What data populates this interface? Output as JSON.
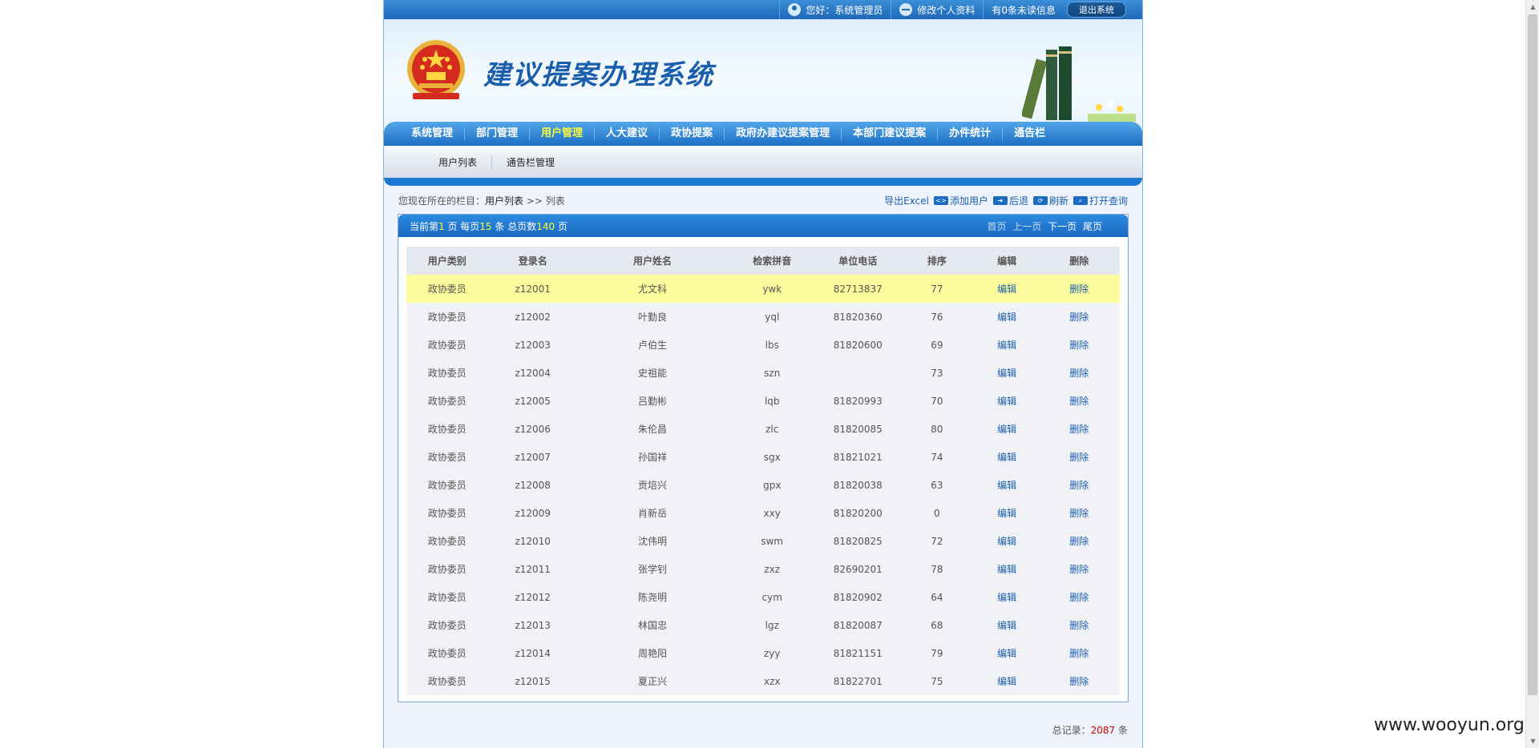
{
  "topbar": {
    "greeting": "您好：系统管理员",
    "edit_profile": "修改个人资料",
    "messages": "有0条未读信息",
    "logout": "退出系统"
  },
  "banner": {
    "title": "建议提案办理系统"
  },
  "nav": {
    "items": [
      "系统管理",
      "部门管理",
      "用户管理",
      "人大建议",
      "政协提案",
      "政府办建议提案管理",
      "本部门建议提案",
      "办件统计",
      "通告栏"
    ],
    "active_index": 2
  },
  "subnav": {
    "items": [
      "用户列表",
      "通告栏管理"
    ]
  },
  "breadcrumb": {
    "prefix": "您现在所在的栏目：",
    "current": "用户列表",
    "sep": " >> ",
    "page": "列表"
  },
  "actions": [
    "导出Excel",
    "添加用户",
    "后退",
    "刷新",
    "打开查询"
  ],
  "paging": {
    "pre": "当前第",
    "page": "1",
    "mid1": " 页 每页",
    "per": "15",
    "mid2": " 条 总页数",
    "pages": "140",
    "post": " 页",
    "first": "首页",
    "prev": "上一页",
    "next": "下一页",
    "last": "尾页"
  },
  "table": {
    "headers": [
      "用户类别",
      "登录名",
      "用户姓名",
      "检索拼音",
      "单位电话",
      "排序",
      "编辑",
      "删除"
    ],
    "rows": [
      [
        "政协委员",
        "z12001",
        "尤文科",
        "ywk",
        "82713837",
        "77",
        "编辑",
        "删除"
      ],
      [
        "政协委员",
        "z12002",
        "叶勤良",
        "yql",
        "81820360",
        "76",
        "编辑",
        "删除"
      ],
      [
        "政协委员",
        "z12003",
        "卢伯生",
        "lbs",
        "81820600",
        "69",
        "编辑",
        "删除"
      ],
      [
        "政协委员",
        "z12004",
        "史祖能",
        "szn",
        "",
        "73",
        "编辑",
        "删除"
      ],
      [
        "政协委员",
        "z12005",
        "吕勤彬",
        "lqb",
        "81820993",
        "70",
        "编辑",
        "删除"
      ],
      [
        "政协委员",
        "z12006",
        "朱伦昌",
        "zlc",
        "81820085",
        "80",
        "编辑",
        "删除"
      ],
      [
        "政协委员",
        "z12007",
        "孙国祥",
        "sgx",
        "81821021",
        "74",
        "编辑",
        "删除"
      ],
      [
        "政协委员",
        "z12008",
        "贡培兴",
        "gpx",
        "81820038",
        "63",
        "编辑",
        "删除"
      ],
      [
        "政协委员",
        "z12009",
        "肖新岳",
        "xxy",
        "81820200",
        "0",
        "编辑",
        "删除"
      ],
      [
        "政协委员",
        "z12010",
        "沈伟明",
        "swm",
        "81820825",
        "72",
        "编辑",
        "删除"
      ],
      [
        "政协委员",
        "z12011",
        "张学钊",
        "zxz",
        "82690201",
        "78",
        "编辑",
        "删除"
      ],
      [
        "政协委员",
        "z12012",
        "陈尧明",
        "cym",
        "81820902",
        "64",
        "编辑",
        "删除"
      ],
      [
        "政协委员",
        "z12013",
        "林国忠",
        "lgz",
        "81820087",
        "68",
        "编辑",
        "删除"
      ],
      [
        "政协委员",
        "z12014",
        "周艳阳",
        "zyy",
        "81821151",
        "79",
        "编辑",
        "删除"
      ],
      [
        "政协委员",
        "z12015",
        "夏正兴",
        "xzx",
        "81822701",
        "75",
        "编辑",
        "删除"
      ]
    ],
    "highlight_row": 0
  },
  "footer": {
    "label": "总记录：",
    "count": "2087",
    "unit": " 条"
  },
  "watermark": "www.wooyun.org",
  "icons": {
    "user": "user-icon",
    "key": "key-icon",
    "emblem": "national-emblem-icon"
  }
}
